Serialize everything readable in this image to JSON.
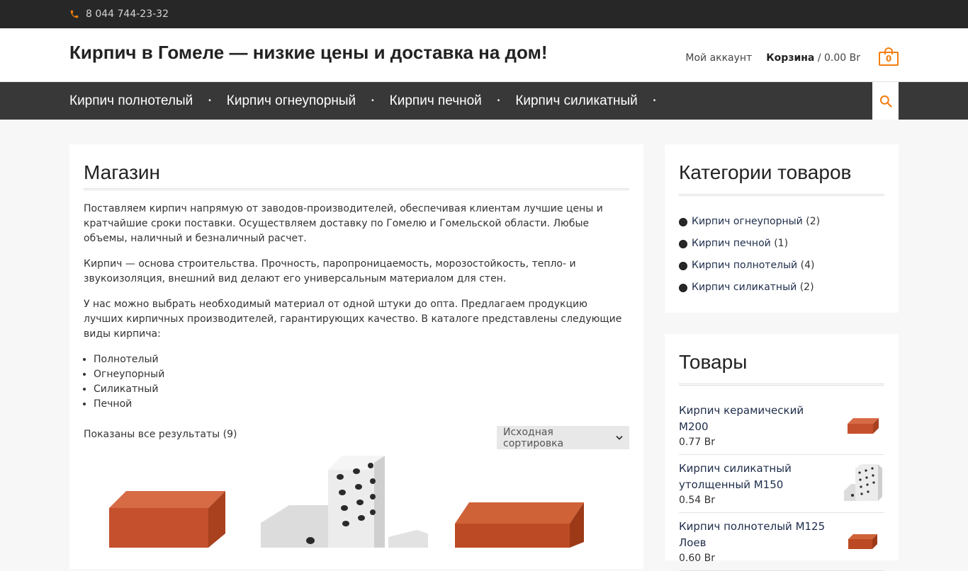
{
  "topbar": {
    "phone": "8 044 744-23-32"
  },
  "header": {
    "site_title": "Кирпич в Гомеле — низкие цены и доставка на дом!",
    "account_label": "Мой аккаунт",
    "cart_label": "Корзина",
    "cart_total": " / 0.00 Br",
    "cart_count": "0"
  },
  "nav": {
    "items": [
      {
        "label": "Кирпич полнотелый"
      },
      {
        "label": "Кирпич огнеупорный"
      },
      {
        "label": "Кирпич печной"
      },
      {
        "label": "Кирпич силикатный"
      }
    ],
    "separator": "•"
  },
  "main": {
    "title": "Магазин",
    "paragraphs": [
      "Поставляем кирпич напрямую от заводов-производителей, обеспечивая клиентам лучшие цены и кратчайшие сроки поставки. Осуществляем доставку по Гомелю и Гомельской области. Любые объемы, наличный и безналичный расчет.",
      "Кирпич — основа строительства. Прочность, паропроницаемость, морозостойкость, тепло- и звукоизоляция, внешний вид делают его универсальным материалом для стен.",
      "У нас можно выбрать необходимый материал от одной штуки до опта. Предлагаем продукцию лучших кирпичных производителей, гарантирующих качество. В каталоге представлены следующие виды кирпича:"
    ],
    "kinds": [
      "Полнотелый",
      "Огнеупорный",
      "Силикатный",
      "Печной"
    ],
    "results_text": "Показаны все результаты (9)",
    "sort_value": "Исходная сортировка"
  },
  "sidebar": {
    "categories_title": "Категории товаров",
    "categories": [
      {
        "name": "Кирпич огнеупорный",
        "count": "(2)"
      },
      {
        "name": "Кирпич печной",
        "count": "(1)"
      },
      {
        "name": "Кирпич полнотелый",
        "count": "(4)"
      },
      {
        "name": "Кирпич силикатный",
        "count": "(2)"
      }
    ],
    "products_title": "Товары",
    "products": [
      {
        "name": "Кирпич керамический М200",
        "price": "0.77 Br"
      },
      {
        "name": "Кирпич силикатный утолщенный М150",
        "price": "0.54 Br"
      },
      {
        "name": "Кирпич полнотелый М125 Лоев",
        "price": "0.60 Br"
      }
    ]
  },
  "colors": {
    "accent": "#f37e0e",
    "nav_bg": "#383838",
    "topbar_bg": "#272727",
    "brick": "#c9502c",
    "silicate": "#e8e8e8"
  }
}
